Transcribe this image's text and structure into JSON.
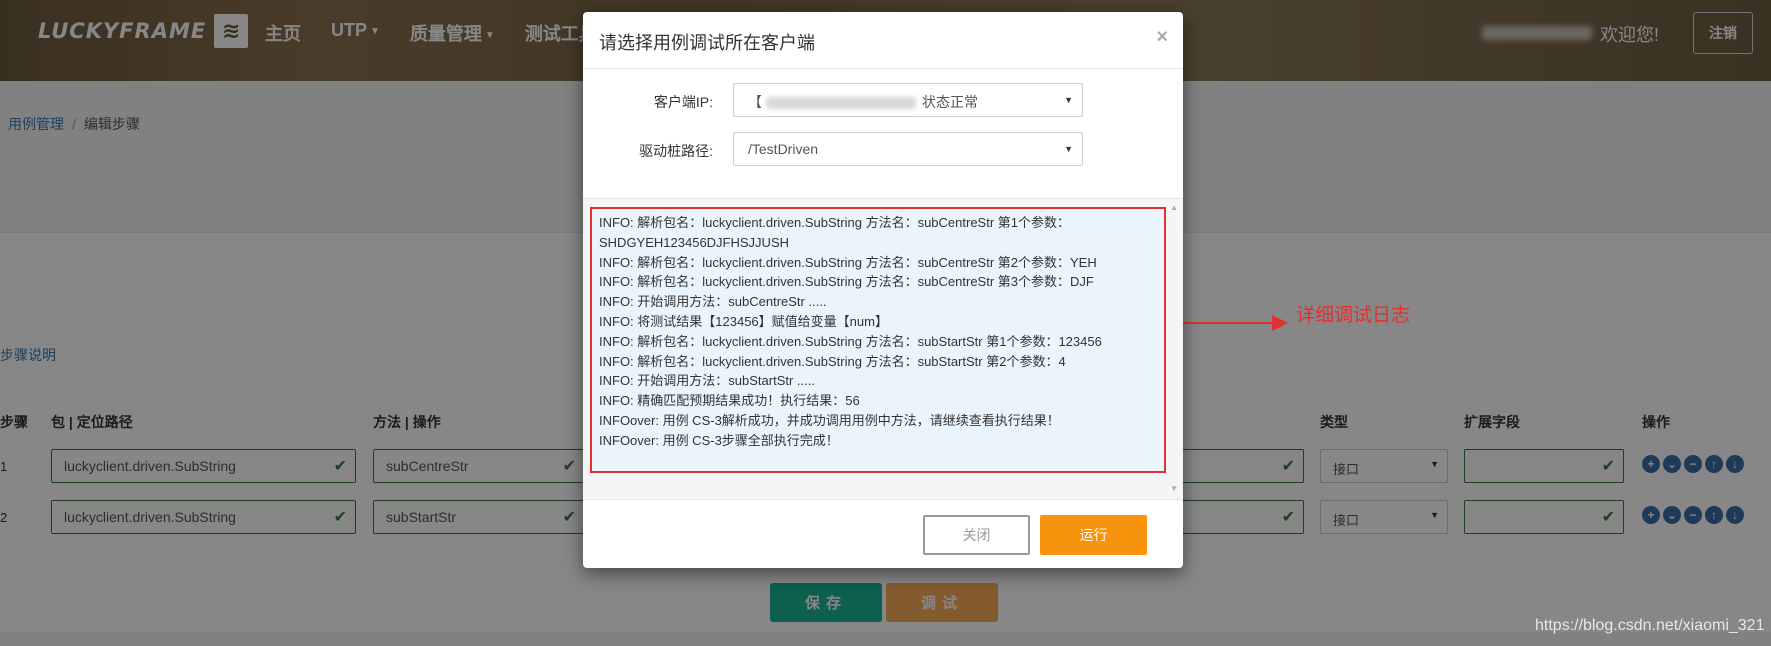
{
  "header": {
    "logo_text": "LUCKYFRAME",
    "nav": [
      "主页",
      "UTP",
      "质量管理",
      "测试工具"
    ],
    "welcome": "欢迎您!",
    "logout": "注销"
  },
  "breadcrumb": {
    "link": "用例管理",
    "current": "编辑步骤"
  },
  "steps_note_link": "步骤说明",
  "table": {
    "headers": [
      "步骤",
      "包 | 定位路径",
      "方法 | 操作",
      "类型",
      "扩展字段",
      "操作"
    ],
    "rows": [
      {
        "num": "1",
        "package": "luckyclient.driven.SubString",
        "method": "subCentreStr",
        "type": "接口"
      },
      {
        "num": "2",
        "package": "luckyclient.driven.SubString",
        "method": "subStartStr",
        "type": "接口"
      }
    ]
  },
  "page_buttons": {
    "save": "保存",
    "debug": "调试"
  },
  "modal": {
    "title": "请选择用例调试所在客户端",
    "client_ip_label": "客户端IP:",
    "client_ip_prefix": "【",
    "client_ip_status": "状态正常",
    "driver_path_label": "驱动桩路径:",
    "driver_path_value": "/TestDriven",
    "log_lines": [
      "INFO: 解析包名：luckyclient.driven.SubString 方法名：subCentreStr 第1个参数：SHDGYEH123456DJFHSJJUSH",
      "INFO: 解析包名：luckyclient.driven.SubString 方法名：subCentreStr 第2个参数：YEH",
      "INFO: 解析包名：luckyclient.driven.SubString 方法名：subCentreStr 第3个参数：DJF",
      "INFO: 开始调用方法：subCentreStr .....",
      "INFO: 将测试结果【123456】赋值给变量【num】",
      "INFO: 解析包名：luckyclient.driven.SubString 方法名：subStartStr 第1个参数：123456",
      "INFO: 解析包名：luckyclient.driven.SubString 方法名：subStartStr 第2个参数：4",
      "INFO: 开始调用方法：subStartStr .....",
      "INFO: 精确匹配预期结果成功！执行结果：56",
      "INFOover: 用例 CS-3解析成功，并成功调用用例中方法，请继续查看执行结果！",
      "INFOover: 用例 CS-3步骤全部执行完成！"
    ],
    "close_button": "关闭",
    "run_button": "运行"
  },
  "annotation": {
    "text": "详细调试日志",
    "color": "#e23030"
  },
  "watermark": "https://blog.csdn.net/xiaomi_321",
  "colors": {
    "save": "#1ab394",
    "debug": "#f8ac59",
    "run": "#f7930d",
    "valid": "#3c763d",
    "link": "#337ab7"
  }
}
